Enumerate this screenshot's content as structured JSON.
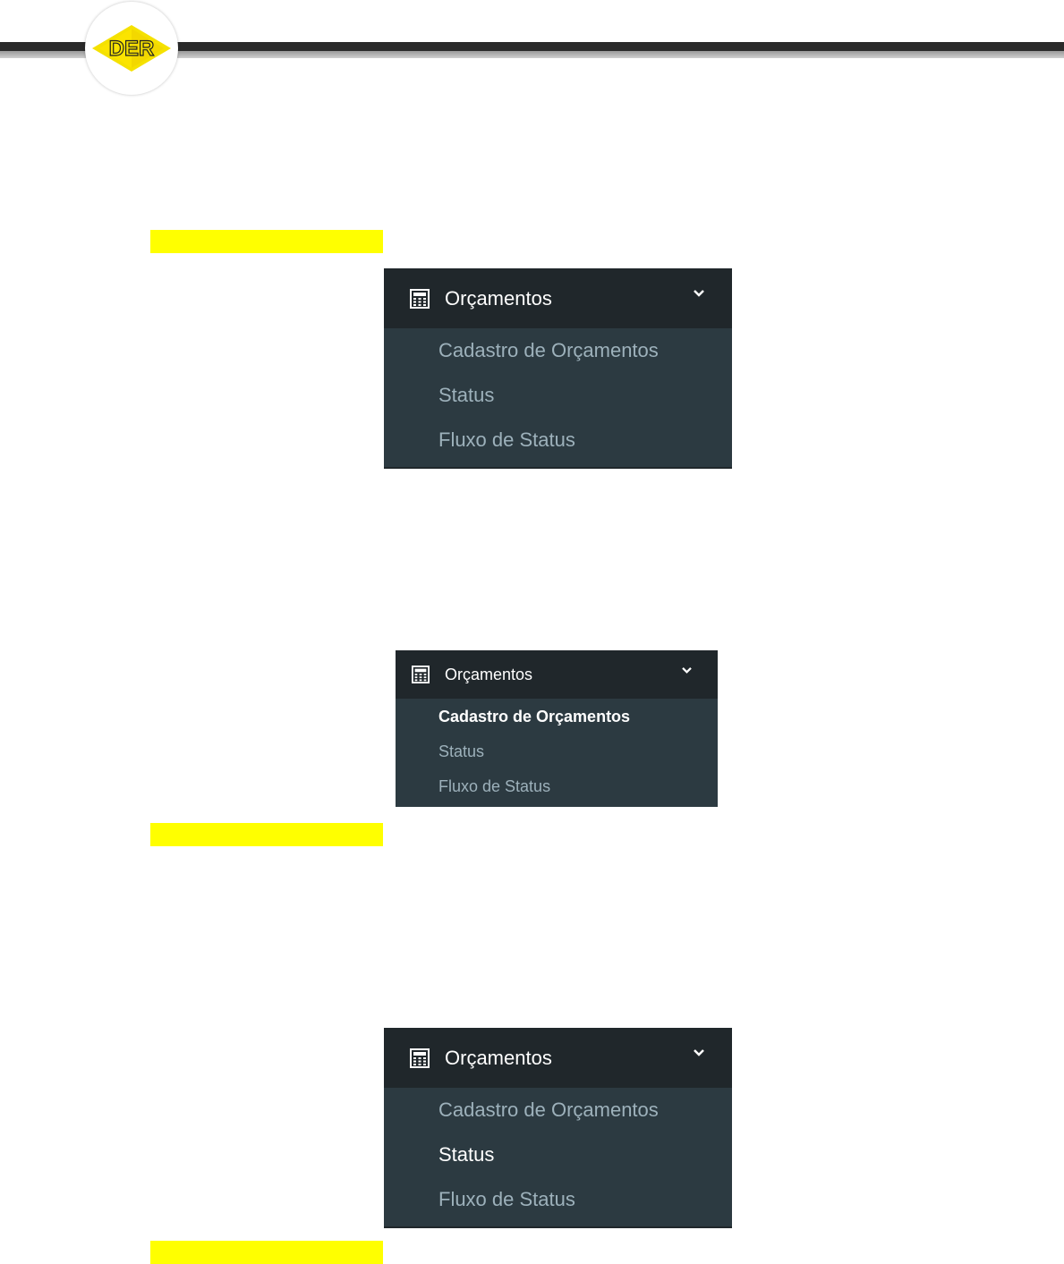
{
  "header": {
    "logo_text": "DER"
  },
  "menus": [
    {
      "title": "Orçamentos",
      "icon": "calculator-icon",
      "toggle_icon": "chevron-down-icon",
      "items": [
        {
          "label": "Cadastro de Orçamentos",
          "active": false
        },
        {
          "label": "Status",
          "active": false
        },
        {
          "label": "Fluxo de Status",
          "active": false
        }
      ]
    },
    {
      "title": "Orçamentos",
      "icon": "calculator-icon",
      "toggle_icon": "chevron-down-icon",
      "items": [
        {
          "label": "Cadastro de Orçamentos",
          "active": true
        },
        {
          "label": "Status",
          "active": false
        },
        {
          "label": "Fluxo de Status",
          "active": false
        }
      ]
    },
    {
      "title": "Orçamentos",
      "icon": "calculator-icon",
      "toggle_icon": "chevron-down-icon",
      "items": [
        {
          "label": "Cadastro de Orçamentos",
          "active": false
        },
        {
          "label": "Status",
          "active": true
        },
        {
          "label": "Fluxo de Status",
          "active": false
        }
      ]
    }
  ],
  "colors": {
    "highlight": "#ffff00",
    "menu_header_bg": "#20272b",
    "menu_body_bg": "#2c3a41",
    "menu_item_text": "#9db1bb",
    "menu_item_active": "#ffffff",
    "logo_yellow": "#f5e100"
  }
}
